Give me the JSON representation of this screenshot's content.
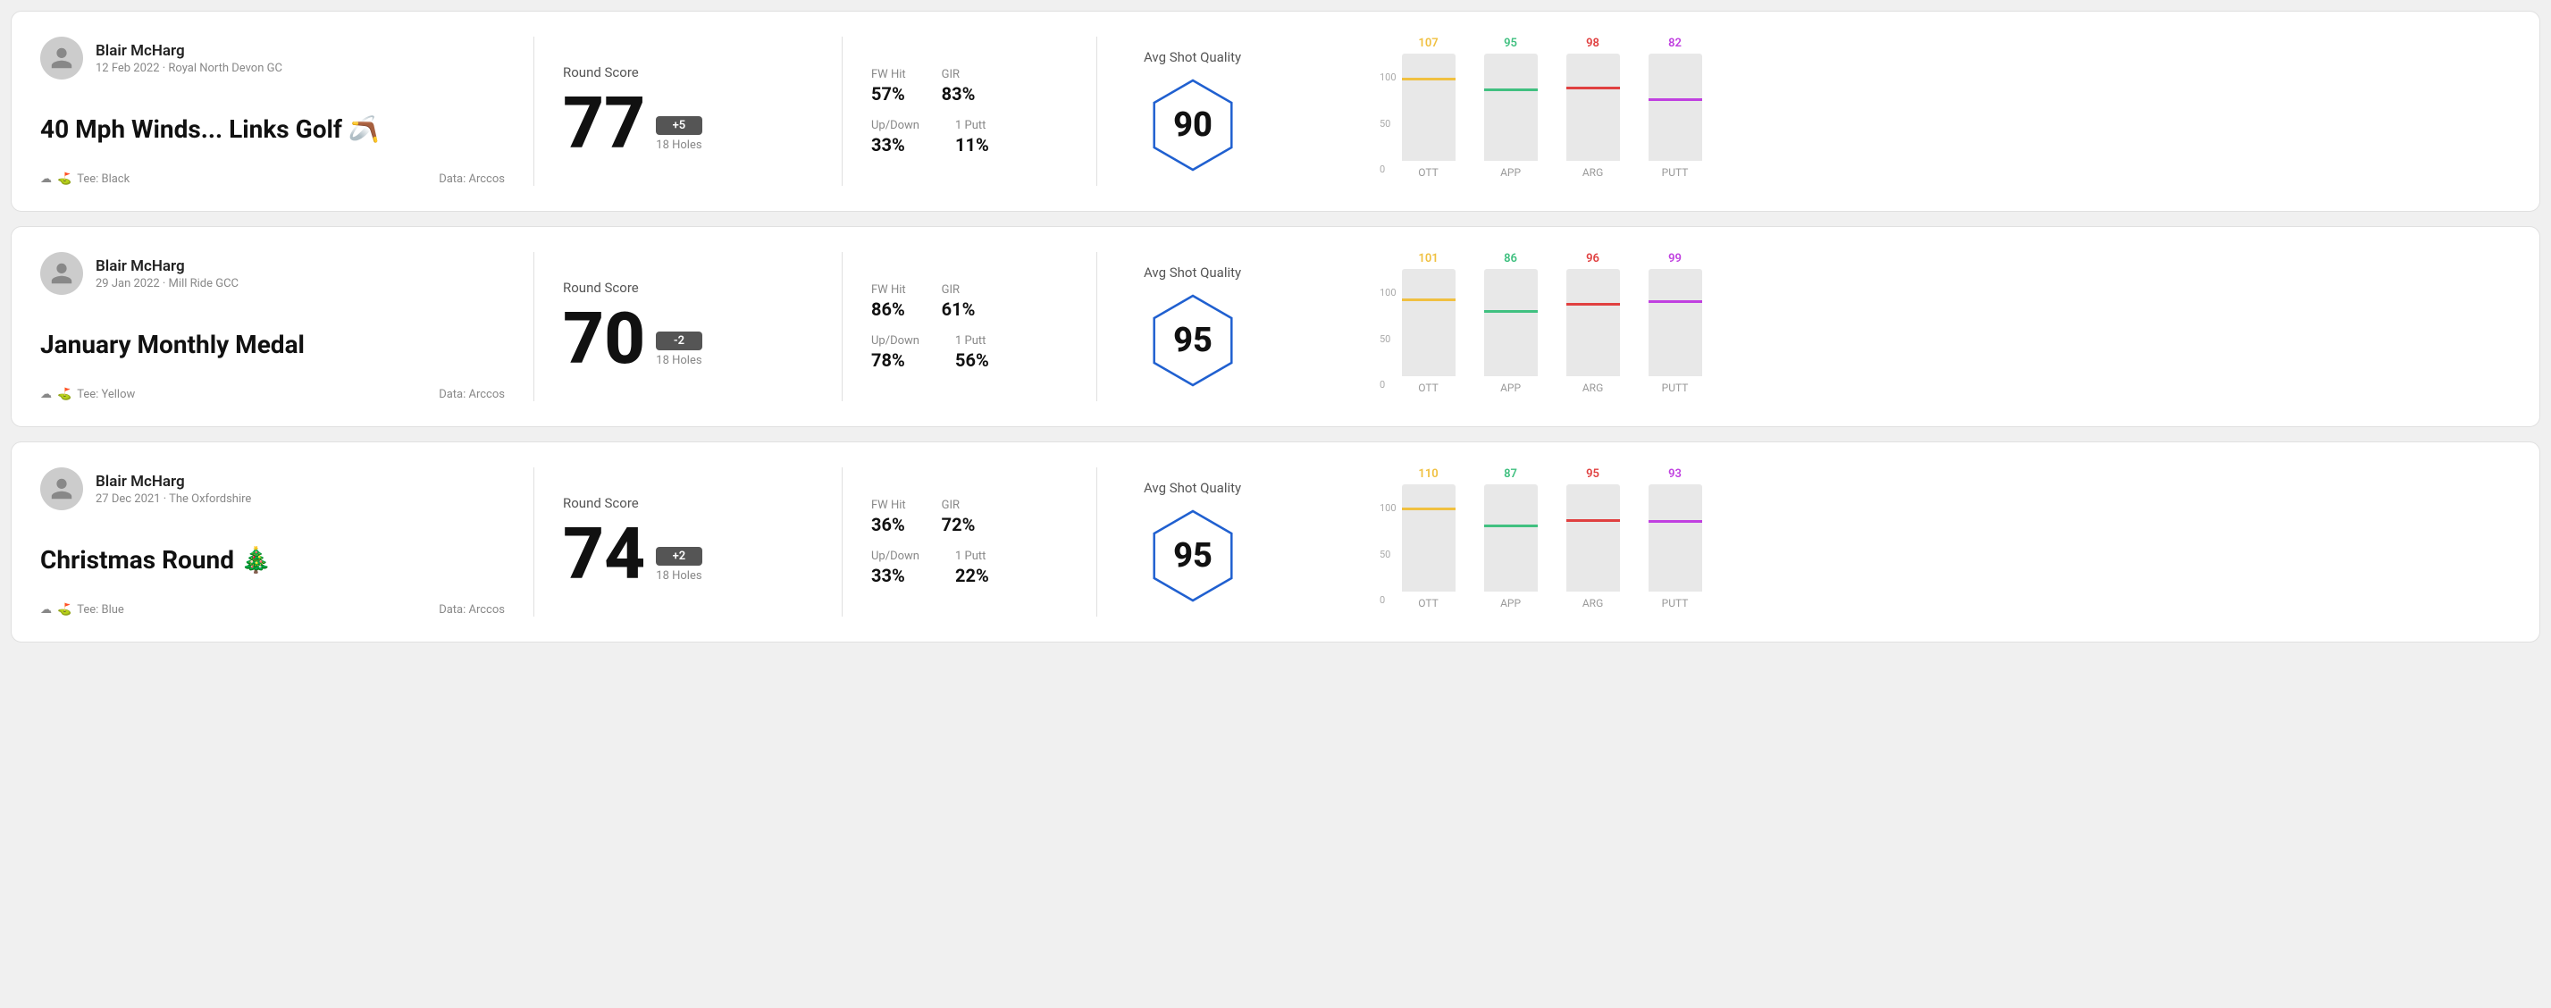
{
  "cards": [
    {
      "id": "card1",
      "user": {
        "name": "Blair McHarg",
        "date": "12 Feb 2022 · Royal North Devon GC"
      },
      "title": "40 Mph Winds... Links Golf 🪃",
      "tee": "Black",
      "data_source": "Data: Arccos",
      "round_score_label": "Round Score",
      "score": "77",
      "badge": "+5",
      "holes": "18 Holes",
      "fw_hit_label": "FW Hit",
      "fw_hit": "57%",
      "gir_label": "GIR",
      "gir": "83%",
      "updown_label": "Up/Down",
      "updown": "33%",
      "oneputt_label": "1 Putt",
      "oneputt": "11%",
      "quality_label": "Avg Shot Quality",
      "quality_score": "90",
      "bars": [
        {
          "label": "OTT",
          "value": 107,
          "color": "#f0c040",
          "pct": 75
        },
        {
          "label": "APP",
          "value": 95,
          "color": "#40c080",
          "pct": 65
        },
        {
          "label": "ARG",
          "value": 98,
          "color": "#e04040",
          "pct": 67
        },
        {
          "label": "PUTT",
          "value": 82,
          "color": "#c040e0",
          "pct": 56
        }
      ]
    },
    {
      "id": "card2",
      "user": {
        "name": "Blair McHarg",
        "date": "29 Jan 2022 · Mill Ride GCC"
      },
      "title": "January Monthly Medal",
      "tee": "Yellow",
      "data_source": "Data: Arccos",
      "round_score_label": "Round Score",
      "score": "70",
      "badge": "-2",
      "holes": "18 Holes",
      "fw_hit_label": "FW Hit",
      "fw_hit": "86%",
      "gir_label": "GIR",
      "gir": "61%",
      "updown_label": "Up/Down",
      "updown": "78%",
      "oneputt_label": "1 Putt",
      "oneputt": "56%",
      "quality_label": "Avg Shot Quality",
      "quality_score": "95",
      "bars": [
        {
          "label": "OTT",
          "value": 101,
          "color": "#f0c040",
          "pct": 70
        },
        {
          "label": "APP",
          "value": 86,
          "color": "#40c080",
          "pct": 59
        },
        {
          "label": "ARG",
          "value": 96,
          "color": "#e04040",
          "pct": 66
        },
        {
          "label": "PUTT",
          "value": 99,
          "color": "#c040e0",
          "pct": 68
        }
      ]
    },
    {
      "id": "card3",
      "user": {
        "name": "Blair McHarg",
        "date": "27 Dec 2021 · The Oxfordshire"
      },
      "title": "Christmas Round 🎄",
      "tee": "Blue",
      "data_source": "Data: Arccos",
      "round_score_label": "Round Score",
      "score": "74",
      "badge": "+2",
      "holes": "18 Holes",
      "fw_hit_label": "FW Hit",
      "fw_hit": "36%",
      "gir_label": "GIR",
      "gir": "72%",
      "updown_label": "Up/Down",
      "updown": "33%",
      "oneputt_label": "1 Putt",
      "oneputt": "22%",
      "quality_label": "Avg Shot Quality",
      "quality_score": "95",
      "bars": [
        {
          "label": "OTT",
          "value": 110,
          "color": "#f0c040",
          "pct": 76
        },
        {
          "label": "APP",
          "value": 87,
          "color": "#40c080",
          "pct": 60
        },
        {
          "label": "ARG",
          "value": 95,
          "color": "#e04040",
          "pct": 65
        },
        {
          "label": "PUTT",
          "value": 93,
          "color": "#c040e0",
          "pct": 64
        }
      ]
    }
  ],
  "y_axis": {
    "top": "100",
    "mid": "50",
    "bot": "0"
  }
}
